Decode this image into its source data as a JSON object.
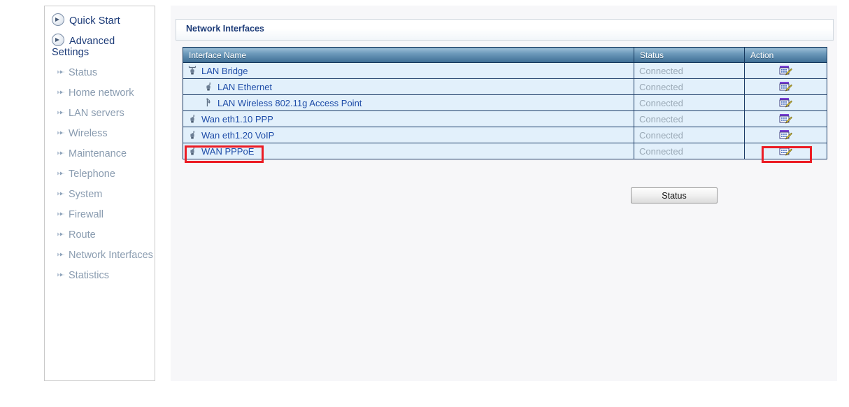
{
  "sidebar": {
    "primary": [
      {
        "label": "Quick Start",
        "icon": "arrow-circle-icon"
      },
      {
        "label": "Advanced Settings",
        "icon": "arrow-circle-icon"
      }
    ],
    "items": [
      {
        "label": "Status",
        "icon": "double-arrow-icon"
      },
      {
        "label": "Home network",
        "icon": "double-arrow-icon"
      },
      {
        "label": "LAN servers",
        "icon": "double-arrow-icon"
      },
      {
        "label": "Wireless",
        "icon": "double-arrow-icon"
      },
      {
        "label": "Maintenance",
        "icon": "double-arrow-icon"
      },
      {
        "label": "Telephone",
        "icon": "double-arrow-icon"
      },
      {
        "label": "System",
        "icon": "double-arrow-icon"
      },
      {
        "label": "Firewall",
        "icon": "double-arrow-icon"
      },
      {
        "label": "Route",
        "icon": "double-arrow-icon"
      },
      {
        "label": "Network Interfaces",
        "icon": "double-arrow-icon"
      },
      {
        "label": "Statistics",
        "icon": "double-arrow-icon"
      }
    ]
  },
  "panel": {
    "title": "Network Interfaces"
  },
  "table": {
    "columns": [
      "Interface Name",
      "Status",
      "Action"
    ],
    "rows": [
      {
        "name": "LAN Bridge",
        "indent": 0,
        "icon": "bridge-connector-icon",
        "status": "Connected",
        "action_icon": "edit-icon"
      },
      {
        "name": "LAN Ethernet",
        "indent": 1,
        "icon": "ethernet-connector-icon",
        "status": "Connected",
        "action_icon": "edit-icon"
      },
      {
        "name": "LAN Wireless 802.11g Access Point",
        "indent": 2,
        "icon": "wireless-antenna-icon",
        "status": "Connected",
        "action_icon": "edit-icon"
      },
      {
        "name": "Wan eth1.10 PPP",
        "indent": 0,
        "icon": "ethernet-connector-icon",
        "status": "Connected",
        "action_icon": "edit-icon"
      },
      {
        "name": "Wan eth1.20 VoIP",
        "indent": 0,
        "icon": "ethernet-connector-icon",
        "status": "Connected",
        "action_icon": "edit-icon"
      },
      {
        "name": "WAN PPPoE",
        "indent": 0,
        "icon": "ethernet-connector-icon",
        "status": "Connected",
        "action_icon": "edit-icon"
      }
    ]
  },
  "buttons": {
    "status": "Status"
  },
  "annotations": {
    "highlight_color": "#ec1c24",
    "boxes": [
      {
        "target": "WAN PPPoE",
        "region": "interface-name-cell"
      },
      {
        "target": "WAN PPPoE",
        "region": "action-cell"
      }
    ]
  },
  "colors": {
    "header_gradient_top": "#9ec0d8",
    "header_gradient_bottom": "#3e6e94",
    "row_background": "#e2f0fb",
    "row_border": "#1a3a66",
    "link_text": "#1f4da8",
    "status_text": "#9aa9b6",
    "title_text": "#1b3a77",
    "sidebar_muted": "#8a9cb0",
    "highlight": "#ec1c24"
  }
}
